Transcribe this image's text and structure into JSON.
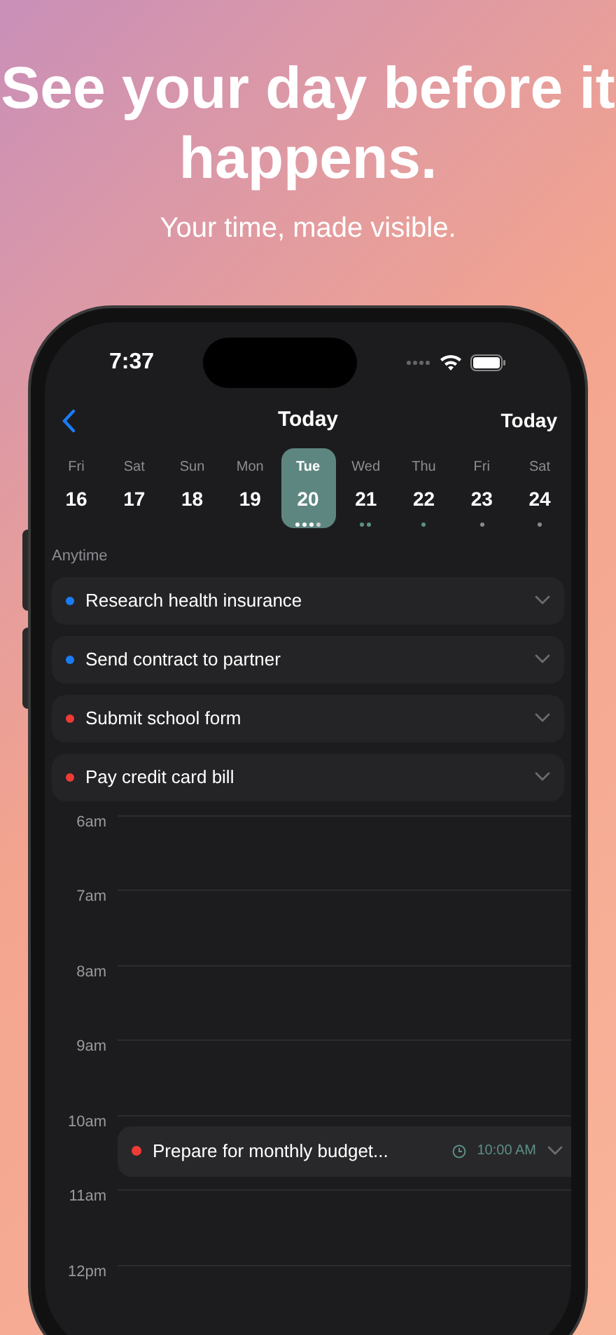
{
  "headline": "See your day before it happens.",
  "subtitle": "Your time, made visible.",
  "status_bar": {
    "time": "7:37"
  },
  "nav": {
    "title": "Today",
    "today_button": "Today"
  },
  "days": [
    {
      "weekday": "Fri",
      "date": "16",
      "selected": false
    },
    {
      "weekday": "Sat",
      "date": "17",
      "selected": false
    },
    {
      "weekday": "Sun",
      "date": "18",
      "selected": false
    },
    {
      "weekday": "Mon",
      "date": "19",
      "selected": false
    },
    {
      "weekday": "Tue",
      "date": "20",
      "selected": true,
      "markers": [
        {
          "color": "#ffffff"
        },
        {
          "color": "#ffffff"
        },
        {
          "color": "#ffffff"
        },
        {
          "color": "#cfcfcf"
        }
      ]
    },
    {
      "weekday": "Wed",
      "date": "21",
      "selected": false,
      "markers": [
        {
          "color": "#5e8f86"
        },
        {
          "color": "#5e8f86"
        }
      ]
    },
    {
      "weekday": "Thu",
      "date": "22",
      "selected": false,
      "markers": [
        {
          "color": "#5e8f86"
        }
      ]
    },
    {
      "weekday": "Fri",
      "date": "23",
      "selected": false,
      "markers": [
        {
          "color": "#8a8a8a"
        }
      ]
    },
    {
      "weekday": "Sat",
      "date": "24",
      "selected": false,
      "markers": [
        {
          "color": "#8a8a8a"
        }
      ]
    }
  ],
  "anytime": {
    "label": "Anytime",
    "tasks": [
      {
        "title": "Research health insurance",
        "color": "#1a7cf5"
      },
      {
        "title": "Send contract to partner",
        "color": "#1a7cf5"
      },
      {
        "title": "Submit school form",
        "color": "#ef3b35"
      },
      {
        "title": "Pay credit card bill",
        "color": "#ef3b35"
      }
    ]
  },
  "timeline": {
    "hours": [
      {
        "label": "6am"
      },
      {
        "label": "7am"
      },
      {
        "label": "8am"
      },
      {
        "label": "9am"
      },
      {
        "label": "10am",
        "events": [
          {
            "title": "Prepare for monthly budget...",
            "time": "10:00 AM",
            "color": "#ef3b35"
          }
        ]
      },
      {
        "label": "11am"
      },
      {
        "label": "12pm"
      }
    ]
  }
}
